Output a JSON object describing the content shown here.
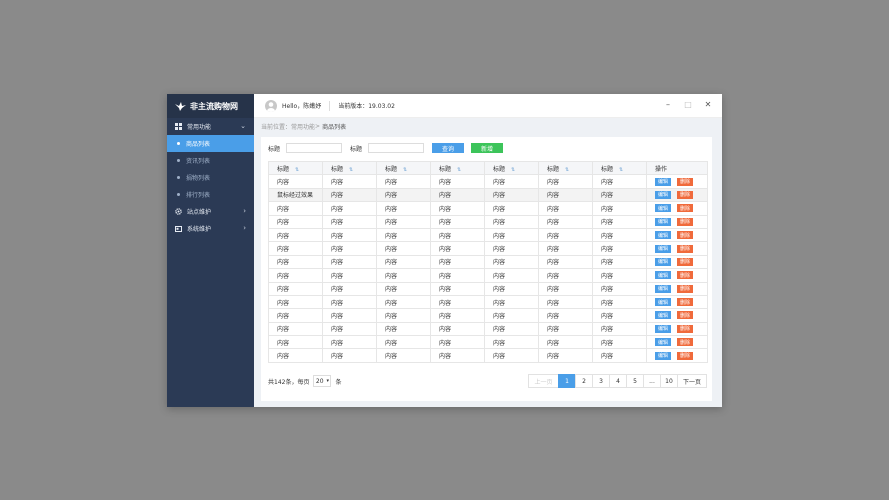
{
  "sidebar": {
    "logo_text": "非主流购物网",
    "groups": [
      {
        "label": "常用功能",
        "icon": "grid-icon",
        "items": [
          {
            "label": "商品列表",
            "active": true
          },
          {
            "label": "资讯列表",
            "active": false
          },
          {
            "label": "捐物列表",
            "active": false
          },
          {
            "label": "排行列表",
            "active": false
          }
        ]
      },
      {
        "label": "站点维护",
        "icon": "gear-icon"
      },
      {
        "label": "系统维护",
        "icon": "id-card-icon"
      }
    ]
  },
  "header": {
    "greeting": "Hello，陈嫩妤",
    "version": "当前版本：19.03.02"
  },
  "breadcrumb": {
    "prefix": "当前位置：",
    "parent": "常用功能",
    "separator": ">",
    "current": "商品列表"
  },
  "search": {
    "label1": "标题",
    "label2": "标题",
    "query_button": "查询",
    "add_button": "新增"
  },
  "table": {
    "columns": [
      "标题",
      "标题",
      "标题",
      "标题",
      "标题",
      "标题",
      "标题",
      "操作"
    ],
    "rows": [
      [
        "内容",
        "内容",
        "内容",
        "内容",
        "内容",
        "内容",
        "内容"
      ],
      [
        "鼠标经过效果",
        "内容",
        "内容",
        "内容",
        "内容",
        "内容",
        "内容"
      ],
      [
        "内容",
        "内容",
        "内容",
        "内容",
        "内容",
        "内容",
        "内容"
      ],
      [
        "内容",
        "内容",
        "内容",
        "内容",
        "内容",
        "内容",
        "内容"
      ],
      [
        "内容",
        "内容",
        "内容",
        "内容",
        "内容",
        "内容",
        "内容"
      ],
      [
        "内容",
        "内容",
        "内容",
        "内容",
        "内容",
        "内容",
        "内容"
      ],
      [
        "内容",
        "内容",
        "内容",
        "内容",
        "内容",
        "内容",
        "内容"
      ],
      [
        "内容",
        "内容",
        "内容",
        "内容",
        "内容",
        "内容",
        "内容"
      ],
      [
        "内容",
        "内容",
        "内容",
        "内容",
        "内容",
        "内容",
        "内容"
      ],
      [
        "内容",
        "内容",
        "内容",
        "内容",
        "内容",
        "内容",
        "内容"
      ],
      [
        "内容",
        "内容",
        "内容",
        "内容",
        "内容",
        "内容",
        "内容"
      ],
      [
        "内容",
        "内容",
        "内容",
        "内容",
        "内容",
        "内容",
        "内容"
      ],
      [
        "内容",
        "内容",
        "内容",
        "内容",
        "内容",
        "内容",
        "内容"
      ],
      [
        "内容",
        "内容",
        "内容",
        "内容",
        "内容",
        "内容",
        "内容"
      ]
    ],
    "edit_label": "编辑",
    "delete_label": "删除"
  },
  "footer": {
    "total_text": "共142条，每页",
    "page_size": "20",
    "unit": "条"
  },
  "pager": {
    "prev": "上一页",
    "pages": [
      "1",
      "2",
      "3",
      "4",
      "5",
      "...",
      "10"
    ],
    "next": "下一页",
    "current": "1"
  },
  "colors": {
    "sidebar_bg": "#2b3a55",
    "accent": "#4a9ee8",
    "add": "#3cc45a",
    "delete": "#f06a3b"
  }
}
